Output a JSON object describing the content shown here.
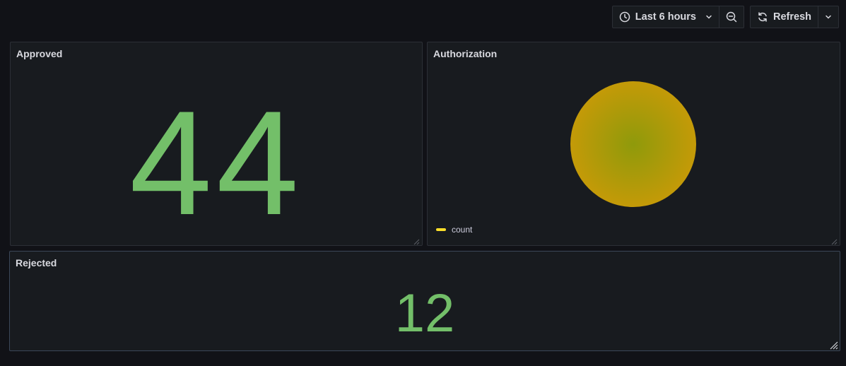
{
  "toolbar": {
    "time_range_label": "Last 6 hours",
    "refresh_label": "Refresh"
  },
  "panels": {
    "approved": {
      "title": "Approved",
      "value": "44"
    },
    "authorization": {
      "title": "Authorization",
      "legend": [
        {
          "label": "count",
          "color": "#fade2a"
        }
      ],
      "pie_color": "#c49a08"
    },
    "rejected": {
      "title": "Rejected",
      "value": "12"
    }
  },
  "colors": {
    "stat_green": "#73bf69",
    "background": "#111217",
    "panel_bg": "#181b1f"
  }
}
